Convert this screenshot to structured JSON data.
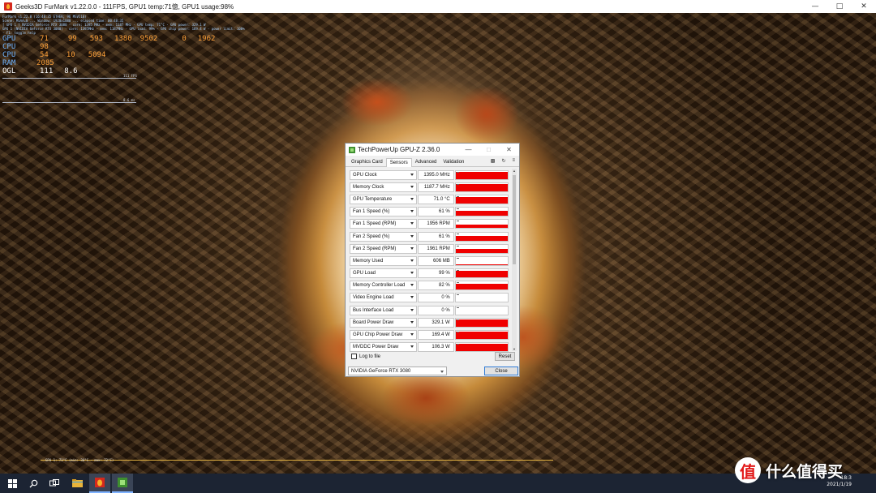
{
  "furmark": {
    "title": "Geeks3D FurMark v1.22.0.0 - 111FPS, GPU1 temp:71億, GPU1 usage:98%",
    "osd": {
      "tiny_lines": [
        "FurMark v1.22.0 (16:48:35 ETHER; 96 MSVC10)",
        "Scene: MSAA=0 ... Window: 1920x1080 ... elapsed time: 00:48:35",
        "[ GPU 1 ] NVIDIA GeForce RTX 3080 - core: 1395 MHz - mem: 1187 MHz - GPU temp: 71°C - GPU power: 329.1 W",
        "GPU 1 (NVIDIA GeForce RTX 3080) - core: 1395MHz - mem: 1187MHz - GPU load: 99% - GPU chip power: 169.4 W - power limit: 100%",
        "- F1: toggle help"
      ],
      "stats": [
        {
          "label": "GPU",
          "values": [
            "71",
            "99",
            "593",
            "1380",
            "9502",
            "0",
            "1962"
          ]
        },
        {
          "label": "CPU",
          "values": [
            "98"
          ]
        },
        {
          "label": "CPU",
          "values": [
            "54",
            "10",
            "5094"
          ]
        },
        {
          "label": "RAM",
          "values": [
            "2085"
          ]
        },
        {
          "label": "OGL",
          "values": [
            "111",
            "8.6"
          ]
        }
      ],
      "graph_labels": [
        "111 FPS",
        "8.6 ms"
      ],
      "bottom_label": "GPU 1: 71°C (min: 36°C - max: 72°C)"
    }
  },
  "gpuz": {
    "title": "TechPowerUp GPU-Z 2.36.0",
    "tabs": [
      "Graphics Card",
      "Sensors",
      "Advanced",
      "Validation"
    ],
    "tool_icons": [
      "camera-icon",
      "refresh-icon",
      "menu-icon"
    ],
    "sensors": [
      {
        "name": "GPU Clock",
        "value": "1395.0 MHz",
        "level": 0.9
      },
      {
        "name": "Memory Clock",
        "value": "1187.7 MHz",
        "level": 0.85
      },
      {
        "name": "GPU Temperature",
        "value": "71.0 °C",
        "level": 0.75
      },
      {
        "name": "Fan 1 Speed (%)",
        "value": "61 %",
        "level": 0.6
      },
      {
        "name": "Fan 1 Speed (RPM)",
        "value": "1956 RPM",
        "level": 0.45
      },
      {
        "name": "Fan 2 Speed (%)",
        "value": "61 %",
        "level": 0.6
      },
      {
        "name": "Fan 2 Speed (RPM)",
        "value": "1961 RPM",
        "level": 0.45
      },
      {
        "name": "Memory Used",
        "value": "606 MB",
        "level": 0.06
      },
      {
        "name": "GPU Load",
        "value": "99 %",
        "level": 0.85
      },
      {
        "name": "Memory Controller Load",
        "value": "82 %",
        "level": 0.7
      },
      {
        "name": "Video Engine Load",
        "value": "0 %",
        "level": 0
      },
      {
        "name": "Bus Interface Load",
        "value": "0 %",
        "level": 0
      },
      {
        "name": "Board Power Draw",
        "value": "329.1 W",
        "level": 0.9
      },
      {
        "name": "GPU Chip Power Draw",
        "value": "169.4 W",
        "level": 0.9
      },
      {
        "name": "MVDDC Power Draw",
        "value": "106.3 W",
        "level": 0.9
      }
    ],
    "log_label": "Log to file",
    "reset_label": "Reset",
    "device": "NVIDIA GeForce RTX 3080",
    "close_label": "Close"
  },
  "taskbar": {
    "time": "18:3",
    "date": "2021/1/19"
  },
  "watermark": {
    "logo": "值",
    "text": "什么值得买"
  },
  "colors": {
    "sensor_graph": "#f00000",
    "osd_label": "#6fb4ff",
    "osd_value": "#ffa23a"
  }
}
